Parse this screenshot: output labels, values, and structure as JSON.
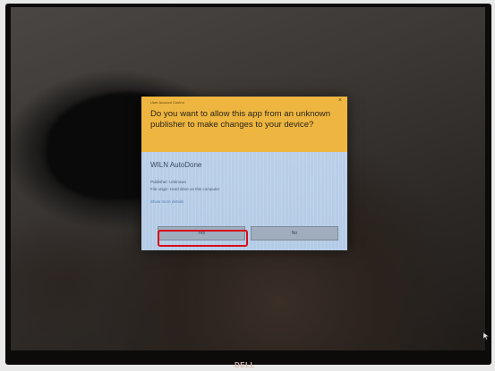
{
  "dialog": {
    "caption": "User Account Control",
    "close_symbol": "×",
    "question": "Do you want to allow this app from an unknown publisher to make changes to your device?",
    "app_name": "WILN AutoDone",
    "publisher_line": "Publisher: Unknown",
    "origin_line": "File origin: Hard drive on this computer",
    "more_details_link": "Show more details",
    "yes_label": "Yes",
    "no_label": "No"
  },
  "monitor": {
    "logo_text": "DELL"
  },
  "colors": {
    "header_bg": "#eeb641",
    "body_bg": "#b8ceea",
    "highlight": "#d80d18"
  },
  "icons": {
    "close": "close-icon",
    "cursor": "mouse-cursor-icon"
  }
}
